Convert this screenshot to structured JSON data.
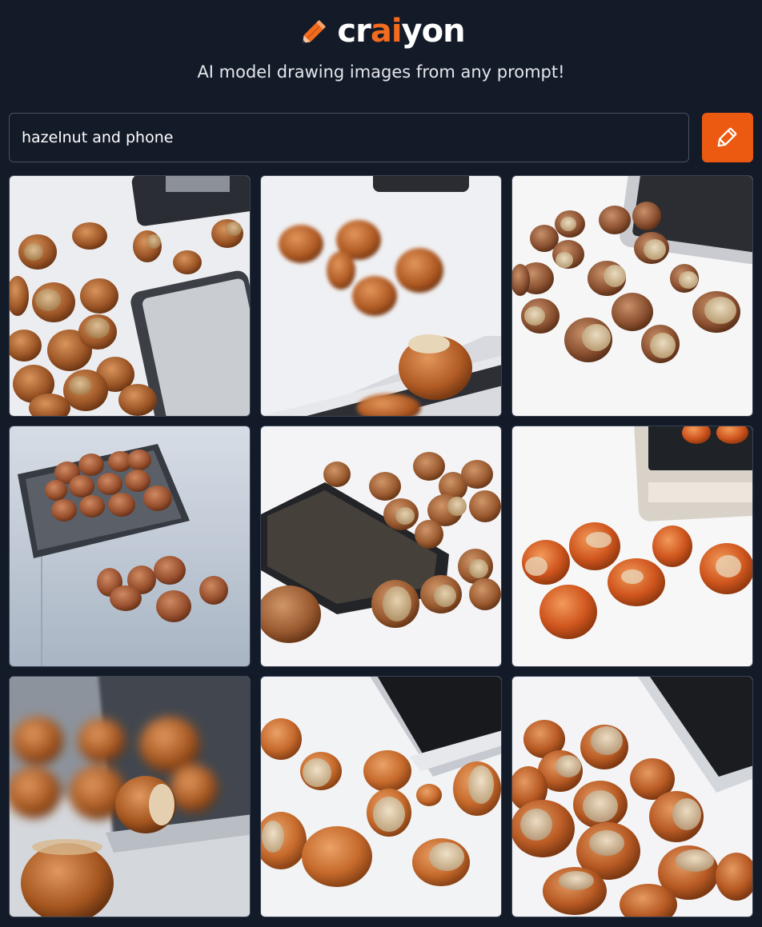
{
  "header": {
    "logo_prefix": "cr",
    "logo_accent": "ai",
    "logo_suffix": "yon",
    "tagline": "AI model drawing images from any prompt!"
  },
  "prompt": {
    "value": "hazelnut and phone"
  },
  "colors": {
    "background": "#131a28",
    "accent": "#ec5a12",
    "logo_accent": "#f26b1f"
  },
  "icons": {
    "logo": "pencil-icon",
    "draw_button": "pencil-icon"
  },
  "results": {
    "count": 9,
    "layout": "3x3 grid"
  }
}
